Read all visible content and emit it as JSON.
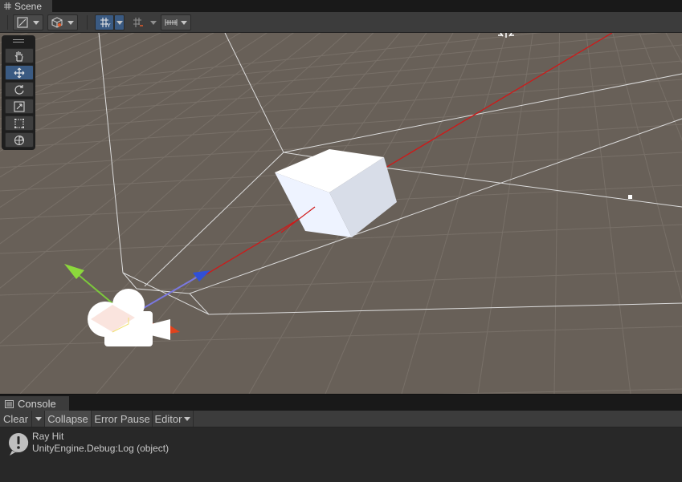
{
  "scene": {
    "tab_label": "Scene",
    "toolbar": {
      "draw_mode_icon": "shading-mode-icon",
      "render_mode_icon": "gizmo-cube-icon",
      "grid_snap_icon": "grid-y-icon",
      "snap_icon": "grid-snap-icon",
      "increment_icon": "increment-snap-icon"
    },
    "tools": [
      {
        "name": "hand-tool",
        "icon": "hand-icon",
        "active": false
      },
      {
        "name": "move-tool",
        "icon": "move-arrows-icon",
        "active": true
      },
      {
        "name": "rotate-tool",
        "icon": "rotate-icon",
        "active": false
      },
      {
        "name": "scale-tool",
        "icon": "scale-icon",
        "active": false
      },
      {
        "name": "rect-tool",
        "icon": "rect-transform-icon",
        "active": false
      },
      {
        "name": "transform-tool",
        "icon": "transform-icon",
        "active": false
      }
    ],
    "colors": {
      "background": "#686058",
      "ray": "#d01818",
      "x_axis": "#e0421c",
      "y_axis": "#7cc83c",
      "z_axis": "#3050d8",
      "cube": "#f4f8ff"
    }
  },
  "console": {
    "tab_label": "Console",
    "buttons": {
      "clear": "Clear",
      "collapse": "Collapse",
      "error_pause": "Error Pause",
      "editor": "Editor"
    },
    "entries": [
      {
        "icon": "info-exclamation-icon",
        "message": "Ray Hit",
        "stack": "UnityEngine.Debug:Log (object)"
      }
    ]
  }
}
